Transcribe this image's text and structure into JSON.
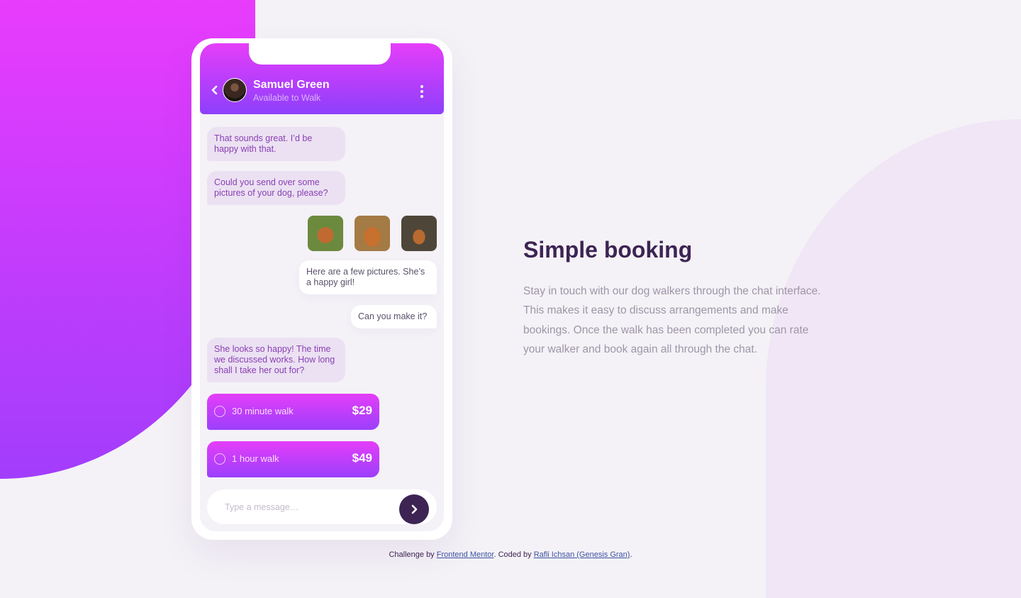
{
  "contact": {
    "name": "Samuel Green",
    "status": "Available to Walk"
  },
  "messages": [
    {
      "direction": "in",
      "text": "That sounds great. I’d be happy with that."
    },
    {
      "direction": "in",
      "text": "Could you send over some pictures of your dog, please?"
    },
    {
      "direction": "out",
      "text": "Here are a few pictures. She’s a happy girl!"
    },
    {
      "direction": "out",
      "text": "Can you make it?"
    },
    {
      "direction": "in",
      "text": "She looks so happy! The time we discussed works. How long shall I take her out for?"
    }
  ],
  "photos": [
    "dog-photo-1",
    "dog-photo-2",
    "dog-photo-3"
  ],
  "offers": [
    {
      "label": "30 minute walk",
      "price": "$29"
    },
    {
      "label": "1 hour walk",
      "price": "$49"
    }
  ],
  "composer": {
    "placeholder": "Type a message…"
  },
  "copy": {
    "title": "Simple booking",
    "text": "Stay in touch with our dog walkers through the chat interface. This makes it easy to discuss arrangements and make bookings. Once the walk has been completed you can rate your walker and book again all through the chat."
  },
  "attribution": {
    "prefix": "Challenge by ",
    "link1": "Frontend Mentor",
    "middle": ". Coded by ",
    "link2": "Rafli Ichsan (Genesis Gran)",
    "suffix": "."
  },
  "colors": {
    "gradient_start": "#e93cfd",
    "gradient_end": "#9e3ffc",
    "dark_violet": "#3d2453",
    "light_bubble": "#ebe1f2",
    "page_bg": "#f4f2f6"
  }
}
